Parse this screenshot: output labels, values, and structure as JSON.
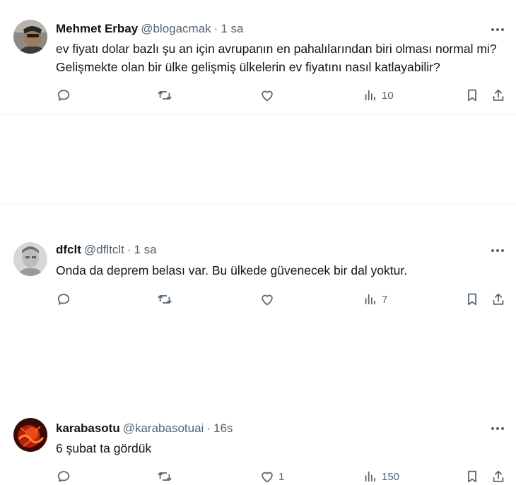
{
  "tweets": [
    {
      "name": "Mehmet Erbay",
      "handle": "@blogacmak",
      "time": "1 sa",
      "text": "ev fiyatı dolar bazlı şu an için avrupanın en pahalılarından biri olması normal mi? Gelişmekte olan bir ülke gelişmiş ülkelerin ev fiyatını nasıl katlayabilir?",
      "likes": "",
      "views": "10"
    },
    {
      "name": "dfclt",
      "handle": "@dfltclt",
      "time": "1 sa",
      "text": "Onda da deprem belası var. Bu ülkede güvenecek bir dal yoktur.",
      "likes": "",
      "views": "7"
    },
    {
      "name": "karabasotu",
      "handle": "@karabasotuai",
      "time": "16s",
      "text": "6 şubat ta gördük",
      "likes": "1",
      "views": "150"
    }
  ],
  "separator": "·",
  "icons": {
    "reply": "reply-icon",
    "retweet": "retweet-icon",
    "like": "heart-icon",
    "views": "views-icon",
    "bookmark": "bookmark-icon",
    "share": "share-icon",
    "more": "more-options-icon"
  },
  "colors": {
    "text": "#0f1419",
    "secondary": "#536471",
    "divider": "#eff3f4"
  }
}
